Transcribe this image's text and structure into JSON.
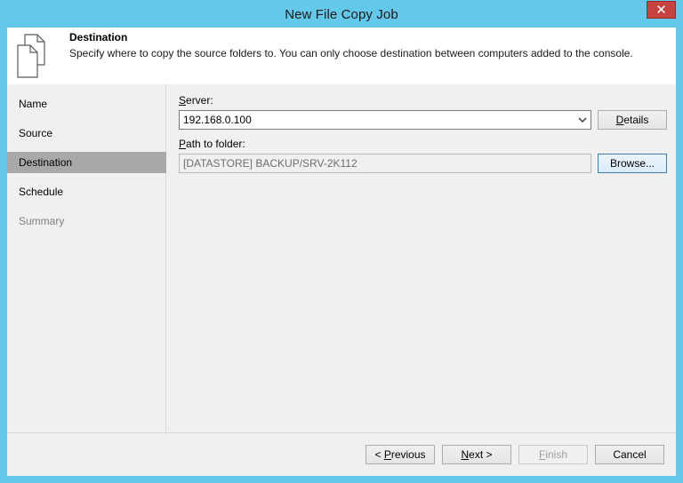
{
  "window": {
    "title": "New File Copy Job",
    "close_glyph": "✕"
  },
  "header": {
    "title": "Destination",
    "description": "Specify where to copy the source folders to. You can only choose destination between computers added to the console.",
    "icon": "document-copy-icon"
  },
  "nav": {
    "items": [
      {
        "label": "Name",
        "state": "normal"
      },
      {
        "label": "Source",
        "state": "normal"
      },
      {
        "label": "Destination",
        "state": "selected"
      },
      {
        "label": "Schedule",
        "state": "normal"
      },
      {
        "label": "Summary",
        "state": "disabled"
      }
    ]
  },
  "form": {
    "server_label_key": "S",
    "server_label_rest": "erver:",
    "server_value": "192.168.0.100",
    "details_key": "D",
    "details_rest": "etails",
    "path_label_key": "P",
    "path_label_rest": "ath to folder:",
    "path_value": "[DATASTORE] BACKUP/SRV-2K112",
    "browse_label": "Browse..."
  },
  "footer": {
    "previous_prefix": "< ",
    "previous_key": "P",
    "previous_rest": "revious",
    "next_key": "N",
    "next_rest": "ext >",
    "finish_key": "F",
    "finish_rest": "inish",
    "cancel_label": "Cancel"
  },
  "colors": {
    "title_bar": "#62c9eb",
    "close_button": "#c7433f",
    "nav_selected": "#a8a8a8",
    "panel_bg": "#f0f0f0"
  }
}
